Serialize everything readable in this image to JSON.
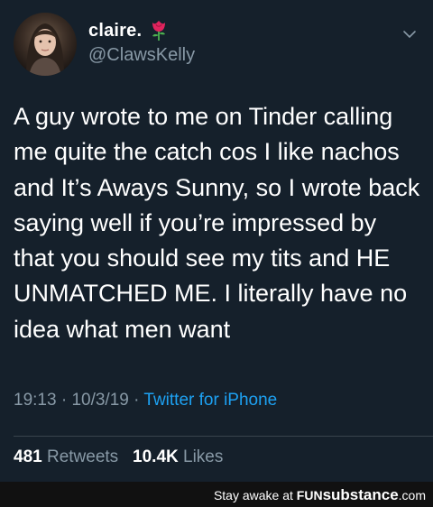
{
  "tweet": {
    "display_name": "claire.",
    "name_emoji_icon": "rose-icon",
    "handle": "@ClawsKelly",
    "text_lines": [
      "A guy wrote to me on Tinder calling",
      "me quite the catch cos I like nachos",
      "and It’s Aways Sunny, so I wrote back",
      "saying well if you’re impressed by",
      "that you should see my tits and HE",
      "UNMATCHED ME. I literally have no",
      "idea what men want"
    ],
    "time": "19:13",
    "date": "10/3/19",
    "separator": "·",
    "source": "Twitter for iPhone",
    "retweets_count": "481",
    "retweets_label": "Retweets",
    "likes_count": "10.4K",
    "likes_label": "Likes"
  },
  "footer": {
    "prefix": "Stay awake at ",
    "brand_main": "FUN",
    "brand_sub": "substance",
    "brand_suffix": ".com"
  },
  "colors": {
    "background": "#15202b",
    "secondary_text": "#8899a6",
    "link": "#1da1f2",
    "divider": "#38444d"
  }
}
